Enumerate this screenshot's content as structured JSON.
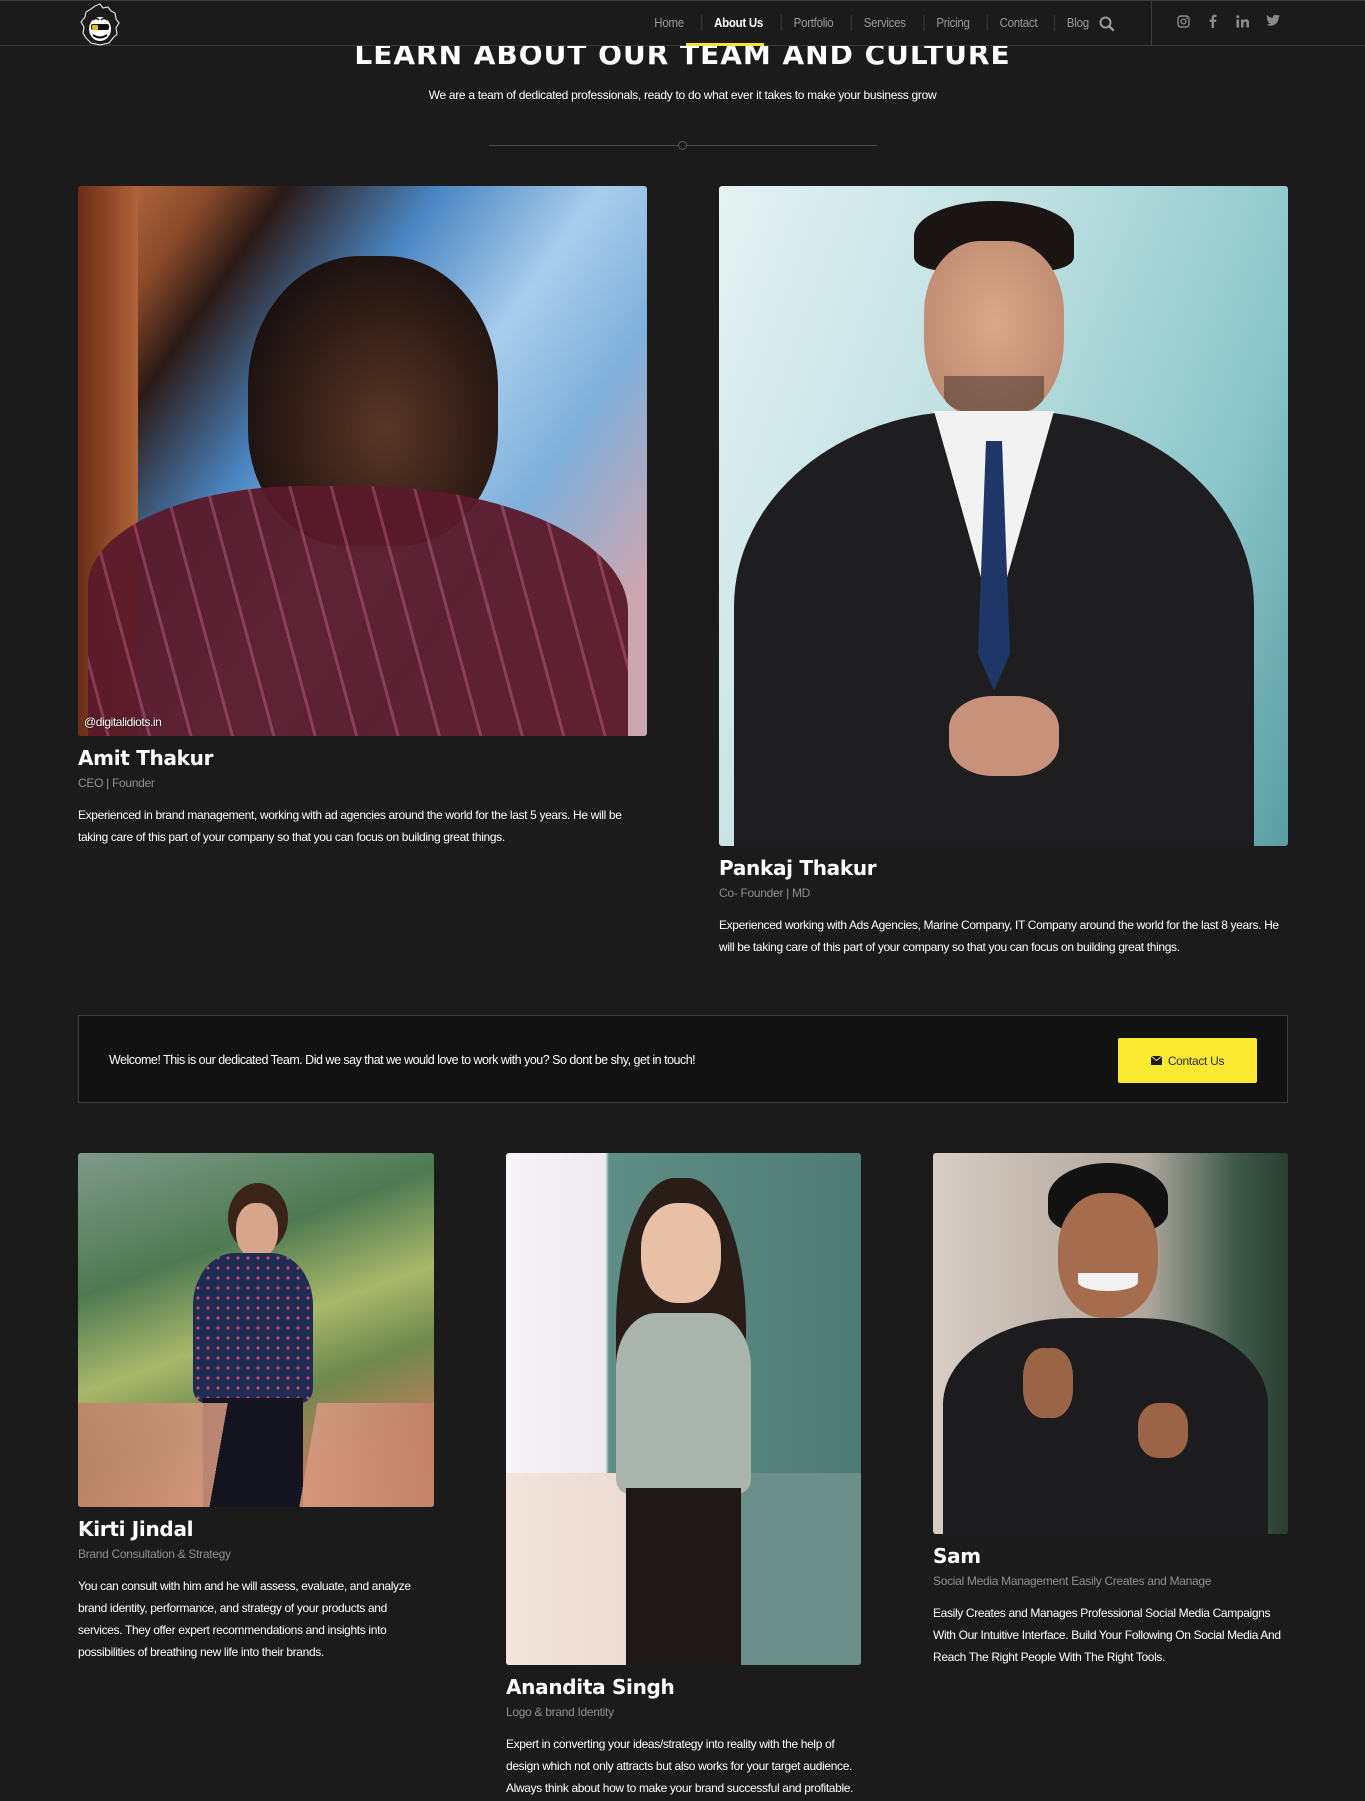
{
  "header": {
    "logo_alt": "Digital Idiots gorilla logo",
    "nav": [
      {
        "label": "Home",
        "active": false
      },
      {
        "label": "About Us",
        "active": true
      },
      {
        "label": "Portfolio",
        "active": false
      },
      {
        "label": "Services",
        "active": false
      },
      {
        "label": "Pricing",
        "active": false
      },
      {
        "label": "Contact",
        "active": false
      },
      {
        "label": "Blog",
        "active": false
      }
    ],
    "search_icon": "search-icon",
    "social": [
      "instagram-icon",
      "facebook-icon",
      "linkedin-icon",
      "twitter-icon"
    ],
    "accent_color": "#f7e630"
  },
  "intro": {
    "title": "LEARN ABOUT OUR TEAM AND CULTURE",
    "subtitle": "We are a team of dedicated professionals, ready to do what ever it takes to make your business grow"
  },
  "team_top": [
    {
      "name": "Amit Thakur",
      "role": "CEO | Founder",
      "photo_tag": "@digitalidiots.in",
      "description": "Experienced in brand management, working with ad agencies around the world for the last 5 years. He will be taking care of this part of your company so that you can focus on building great things."
    },
    {
      "name": "Pankaj Thakur",
      "role": "Co- Founder | MD",
      "description": "Experienced working with Ads Agencies, Marine Company, IT Company around the world for the last 8 years. He will be taking care of this part of your company so that you can focus on building great things."
    }
  ],
  "cta": {
    "text": "Welcome! This is our dedicated Team. Did we say that we would love to work with you? So dont be shy, get in touch!",
    "button_label": "Contact Us",
    "button_icon": "envelope-icon",
    "button_color": "#fbe932"
  },
  "team_bottom": [
    {
      "name": "Kirti Jindal",
      "role": "Brand Consultation & Strategy",
      "description": "You can consult with him and he will assess, evaluate, and analyze brand identity, performance, and strategy of your products and services. They offer expert recommendations and insights into possibilities of breathing new life into their brands."
    },
    {
      "name": "Anandita Singh",
      "role": "Logo & brand Identity",
      "description": "Expert in converting your ideas/strategy into reality with the help of design which not only attracts but also works for your target audience. Always think about how to make your brand successful and profitable."
    },
    {
      "name": "Sam",
      "role": "Social Media Management Easily Creates and Manage",
      "description": "Easily Creates and Manages Professional Social Media Campaigns With Our Intuitive Interface. Build Your Following On Social Media And Reach The Right People With The Right Tools."
    }
  ]
}
